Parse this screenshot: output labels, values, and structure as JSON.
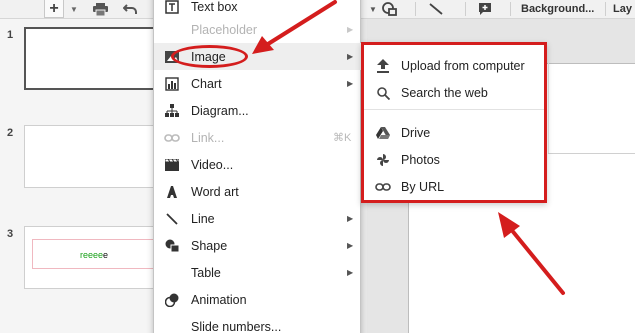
{
  "toolbar": {
    "add_icon": "plus-icon",
    "caret_icon": "caret-down-icon",
    "print_icon": "print-icon",
    "undo_icon": "undo-icon",
    "shape_icon": "shape-icon",
    "line_icon": "line-icon",
    "comment_icon": "comment-add-icon",
    "background_label": "Background...",
    "layout_label": "Lay"
  },
  "filmstrip": {
    "slides": [
      {
        "number": "1",
        "selected": true
      },
      {
        "number": "2",
        "selected": false
      },
      {
        "number": "3",
        "selected": false,
        "text": "reeeee"
      }
    ]
  },
  "insert_menu": {
    "items": [
      {
        "label": "Text box",
        "icon": "text-box-icon",
        "enabled": true,
        "submenu": false
      },
      {
        "label": "Placeholder",
        "icon": "",
        "enabled": false,
        "submenu": true
      },
      {
        "label": "Image",
        "icon": "image-icon",
        "enabled": true,
        "submenu": true,
        "highlighted": true
      },
      {
        "label": "Chart",
        "icon": "chart-icon",
        "enabled": true,
        "submenu": true
      },
      {
        "label": "Diagram...",
        "icon": "diagram-icon",
        "enabled": true,
        "submenu": false
      },
      {
        "label": "Link...",
        "icon": "link-icon",
        "enabled": false,
        "shortcut": "⌘K"
      },
      {
        "label": "Video...",
        "icon": "video-icon",
        "enabled": true,
        "submenu": false
      },
      {
        "label": "Word art",
        "icon": "word-art-icon",
        "enabled": true,
        "submenu": false
      },
      {
        "label": "Line",
        "icon": "line-icon",
        "enabled": true,
        "submenu": true
      },
      {
        "label": "Shape",
        "icon": "shape-icon",
        "enabled": true,
        "submenu": true
      },
      {
        "label": "Table",
        "icon": "",
        "enabled": true,
        "submenu": true
      },
      {
        "label": "Animation",
        "icon": "animation-icon",
        "enabled": true,
        "submenu": false
      },
      {
        "label": "Slide numbers...",
        "icon": "",
        "enabled": true,
        "submenu": false
      }
    ]
  },
  "image_submenu": {
    "items": [
      {
        "label": "Upload from computer",
        "icon": "upload-icon"
      },
      {
        "label": "Search the web",
        "icon": "search-icon"
      },
      {
        "label": "Drive",
        "icon": "drive-icon"
      },
      {
        "label": "Photos",
        "icon": "photos-icon"
      },
      {
        "label": "By URL",
        "icon": "link-icon"
      }
    ]
  },
  "colors": {
    "annotation": "#d41d1d",
    "menu_highlight": "#eeeeee",
    "disabled_text": "#b3b3b3"
  }
}
